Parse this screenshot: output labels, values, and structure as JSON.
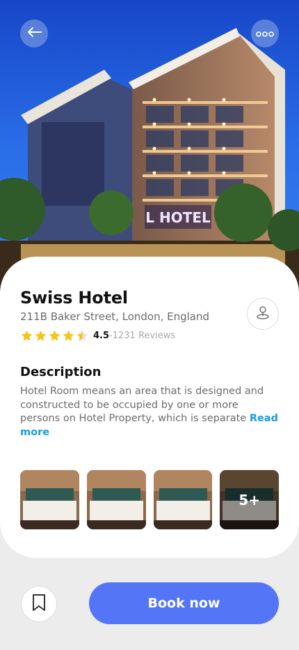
{
  "hotel": {
    "name": "Swiss Hotel",
    "address": "211B Baker Street, London, England",
    "rating": "4.5",
    "reviews": "-1231 Reviews",
    "rating_value": 4.5,
    "sign_text": "L HOTEL"
  },
  "description": {
    "title": "Description",
    "text": "Hotel Room means an area that is designed and constructed to be occupied by one or more persons on Hotel Property, which is separate ",
    "read_more": "Read more"
  },
  "gallery": {
    "more_label": "5+"
  },
  "actions": {
    "book_label": "Book now"
  },
  "icons": {
    "back": "arrow-left-icon",
    "more": "more-horizontal-icon",
    "location": "map-pin-icon",
    "bookmark": "bookmark-icon",
    "star": "star-icon"
  },
  "colors": {
    "primary": "#5575f7",
    "link": "#1a9be0",
    "star": "#f5c518"
  }
}
